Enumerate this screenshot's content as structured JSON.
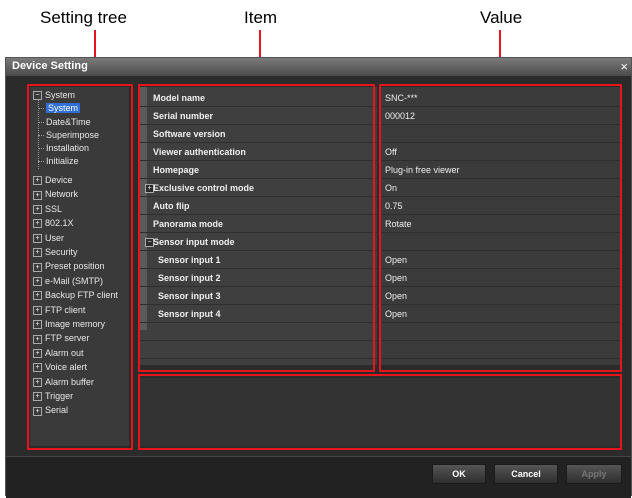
{
  "callouts": {
    "setting_tree": "Setting tree",
    "item": "Item",
    "value": "Value"
  },
  "window": {
    "title": "Device Setting",
    "close_glyph": "×"
  },
  "tree": {
    "system": "System",
    "system_children": [
      "System",
      "Date&Time",
      "Superimpose",
      "Installation",
      "Initialize"
    ],
    "selected_child": "System",
    "collapsed": [
      "Device",
      "Network",
      "SSL",
      "802.1X",
      "User",
      "Security",
      "Preset position",
      "e-Mail (SMTP)",
      "Backup FTP client",
      "FTP client",
      "Image memory",
      "FTP server",
      "Alarm out",
      "Voice alert",
      "Alarm buffer",
      "Trigger",
      "Serial"
    ],
    "expanded_glyph": "−",
    "collapsed_glyph": "+"
  },
  "grid": {
    "rows": [
      {
        "item": "Model name",
        "value": "SNC-***"
      },
      {
        "item": "Serial number",
        "value": "000012"
      },
      {
        "item": "Software version",
        "value": ""
      },
      {
        "item": "Viewer authentication",
        "value": "Off"
      },
      {
        "item": "Homepage",
        "value": "Plug-in free viewer"
      },
      {
        "item": "Exclusive control mode",
        "value": "On",
        "expander": "+"
      },
      {
        "item": "Auto flip",
        "value": "0.75"
      },
      {
        "item": "Panorama mode",
        "value": "Rotate"
      },
      {
        "item": "Sensor input mode",
        "value": "",
        "expander": "−"
      },
      {
        "item": "Sensor input 1",
        "value": "Open",
        "sub": true
      },
      {
        "item": "Sensor input 2",
        "value": "Open",
        "sub": true
      },
      {
        "item": "Sensor input 3",
        "value": "Open",
        "sub": true
      },
      {
        "item": "Sensor input 4",
        "value": "Open",
        "sub": true
      }
    ]
  },
  "buttons": {
    "ok": "OK",
    "cancel": "Cancel",
    "apply": "Apply"
  },
  "colors": {
    "annotation_red": "#e8141b",
    "selection_blue": "#2f6fd6"
  }
}
